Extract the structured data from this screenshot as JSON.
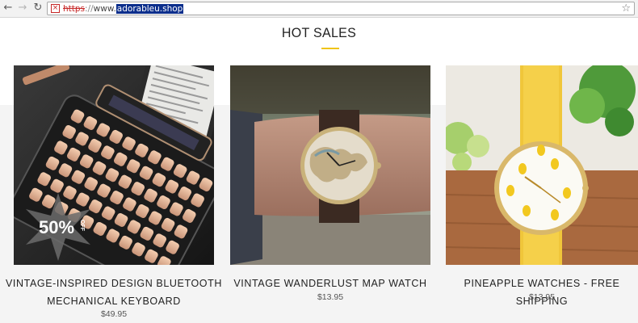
{
  "browser": {
    "url_scheme": "https",
    "url_separator": "://",
    "url_www": "www.",
    "url_host": "adorableu.shop"
  },
  "section": {
    "title": "HOT SALES"
  },
  "products": [
    {
      "title_line1": "VINTAGE-INSPIRED DESIGN BLUETOOTH",
      "title_line2": "MECHANICAL KEYBOARD",
      "price": "$49.95",
      "badge_value": "50%",
      "badge_label": "OFF"
    },
    {
      "title_line1": "VINTAGE WANDERLUST MAP WATCH",
      "price": "$13.95"
    },
    {
      "title_line1": "PINEAPPLE WATCHES - FREE SHIPPING",
      "price": "$13.95"
    }
  ],
  "colors": {
    "accent": "#f0c419",
    "insecure": "#c62828",
    "url_highlight": "#0b2e8c"
  }
}
